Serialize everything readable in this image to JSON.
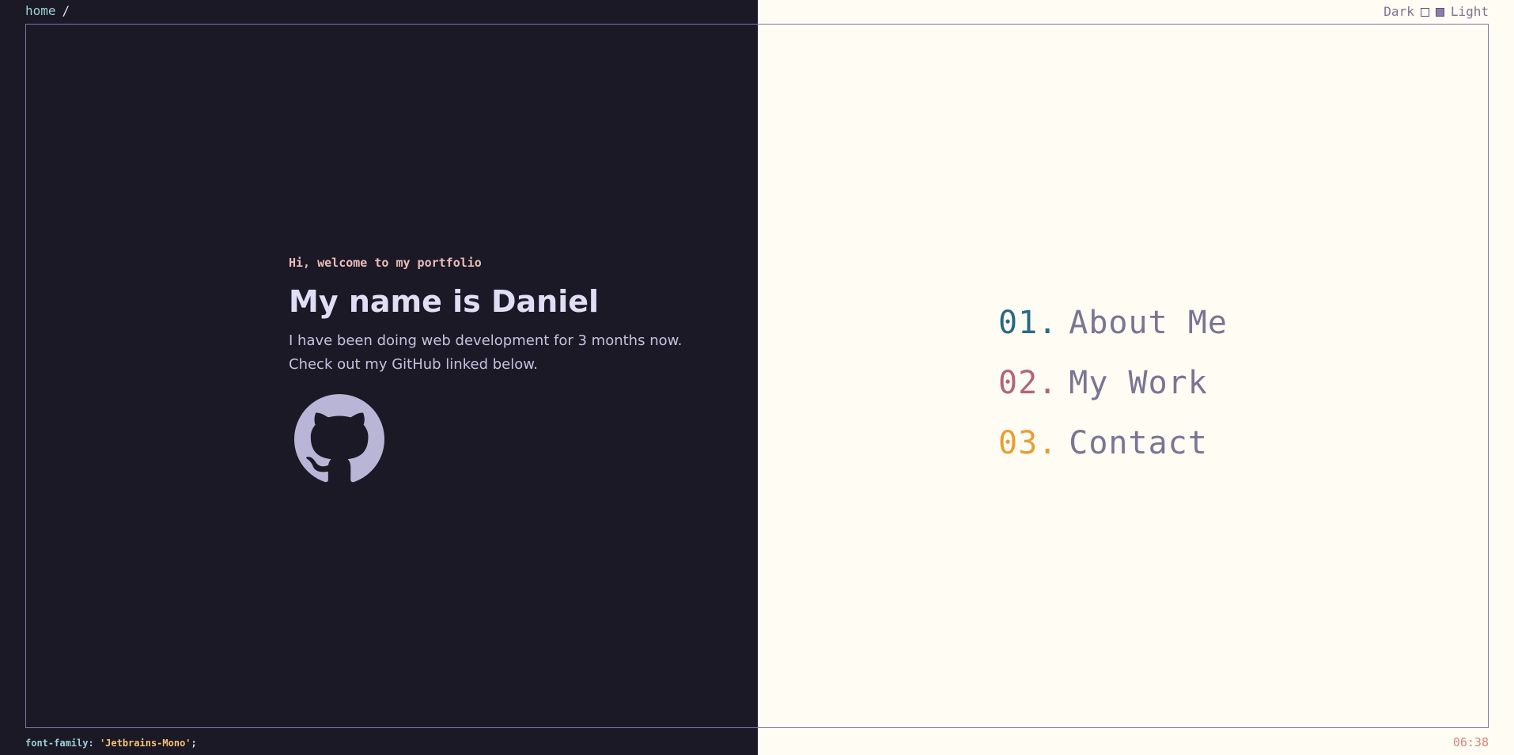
{
  "header": {
    "breadcrumb": "home",
    "breadcrumb_separator": "/",
    "theme_toggle": {
      "dark_label": "Dark",
      "light_label": "Light",
      "selected": "Light"
    }
  },
  "hero": {
    "greeting": "Hi, welcome to my portfolio",
    "title": "My name is Daniel",
    "bio_line1": "I have been doing web development for 3 months now.",
    "bio_line2": "Check out my GitHub linked below.",
    "github_icon": "github-icon"
  },
  "nav": {
    "items": [
      {
        "number": "01.",
        "label": "About Me",
        "color": "#286983"
      },
      {
        "number": "02.",
        "label": "My Work",
        "color": "#b4637a"
      },
      {
        "number": "03.",
        "label": "Contact",
        "color": "#ea9d34"
      }
    ]
  },
  "footer": {
    "font_property": "font-family:",
    "font_value": "'Jetbrains-Mono'",
    "font_terminator": ";",
    "clock": "06:38"
  },
  "colors": {
    "dark_background": "#1b1925",
    "light_background": "#fffcf4",
    "frame_border": "#7a78a8",
    "accent_pink": "#ebbcba",
    "accent_foam": "#9ccfd8",
    "accent_gold": "#f6c177",
    "icon_fill": "#b8b5d6"
  }
}
